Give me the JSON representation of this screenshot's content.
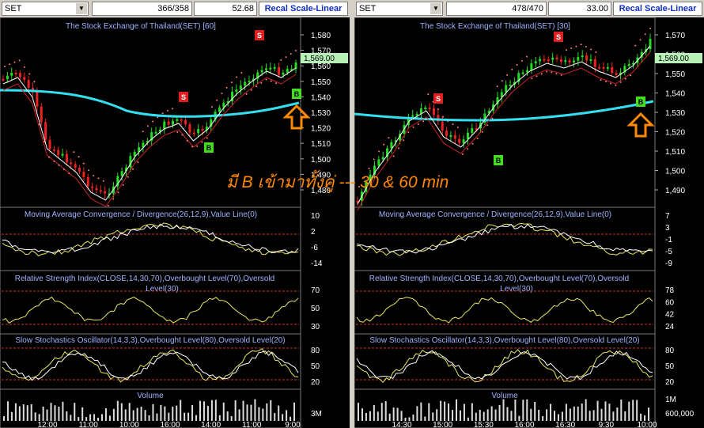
{
  "left": {
    "symbol": "SET",
    "volume_ratio": "366/358",
    "value": "52.68",
    "scale_button": "Recal Scale-Linear",
    "title": "The Stock Exchange of Thailand(SET) [60]",
    "price_tag": "1,569.00",
    "price_ticks": [
      "1,580",
      "1,570",
      "1,560",
      "1,550",
      "1,540",
      "1,530",
      "1,520",
      "1,510",
      "1,500",
      "1,490",
      "1,480"
    ],
    "macd_title": "Moving Average Convergence / Divergence(26,12,9),Value Line(0)",
    "macd_ticks": [
      "10",
      "2",
      "-6",
      "-14"
    ],
    "rsi_title_1": "Relative Strength Index(CLOSE,14,30,70),Overbought Level(70),Oversold",
    "rsi_title_2": "Level(30)",
    "rsi_ticks": [
      "70",
      "50",
      "30"
    ],
    "stoch_title": "Slow Stochastics Oscillator(14,3,3),Overbought Level(80),Oversold Level(20)",
    "stoch_ticks": [
      "80",
      "50",
      "20"
    ],
    "volume_title": "Volume",
    "volume_ticks": [
      "3M"
    ],
    "time_labels": [
      "12:00",
      "11:00",
      "10:00",
      "16:00",
      "14:00",
      "11:00",
      "9:00"
    ],
    "signals": [
      "S",
      "S",
      "B",
      "B"
    ]
  },
  "right": {
    "symbol": "SET",
    "volume_ratio": "478/470",
    "value": "33.00",
    "scale_button": "Recal Scale-Linear",
    "title": "The Stock Exchange of Thailand(SET) [30]",
    "price_tag": "1,569.00",
    "price_ticks": [
      "1,570",
      "1,560",
      "1,550",
      "1,540",
      "1,530",
      "1,520",
      "1,510",
      "1,500",
      "1,490"
    ],
    "macd_title": "Moving Average Convergence / Divergence(26,12,9),Value Line(0)",
    "macd_ticks": [
      "7",
      "3",
      "-1",
      "-5",
      "-9"
    ],
    "rsi_title_1": "Relative Strength Index(CLOSE,14,30,70),Overbought Level(70),Oversold",
    "rsi_title_2": "Level(30)",
    "rsi_ticks": [
      "78",
      "60",
      "42",
      "24"
    ],
    "stoch_title": "Slow Stochastics Oscillator(14,3,3),Overbought Level(80),Oversold Level(20)",
    "stoch_ticks": [
      "80",
      "50",
      "20"
    ],
    "volume_title": "Volume",
    "volume_ticks": [
      "1M",
      "600,000"
    ],
    "time_labels": [
      "14:30",
      "15:00",
      "15:30",
      "16:00",
      "16:30",
      "9:30",
      "10:00"
    ],
    "signals": [
      "S",
      "S",
      "B",
      "B"
    ]
  },
  "annotation": "มี B เข้ามาทั้งคู่ --- 30 & 60 min",
  "colors": {
    "bull": "#22dd22",
    "bear": "#ee2222",
    "ma_thick": "#33e0f0",
    "sar": "#ff7a7a",
    "arrow": "#ff8a00",
    "sell_box": "#e02020",
    "buy_box": "#44dd22"
  }
}
